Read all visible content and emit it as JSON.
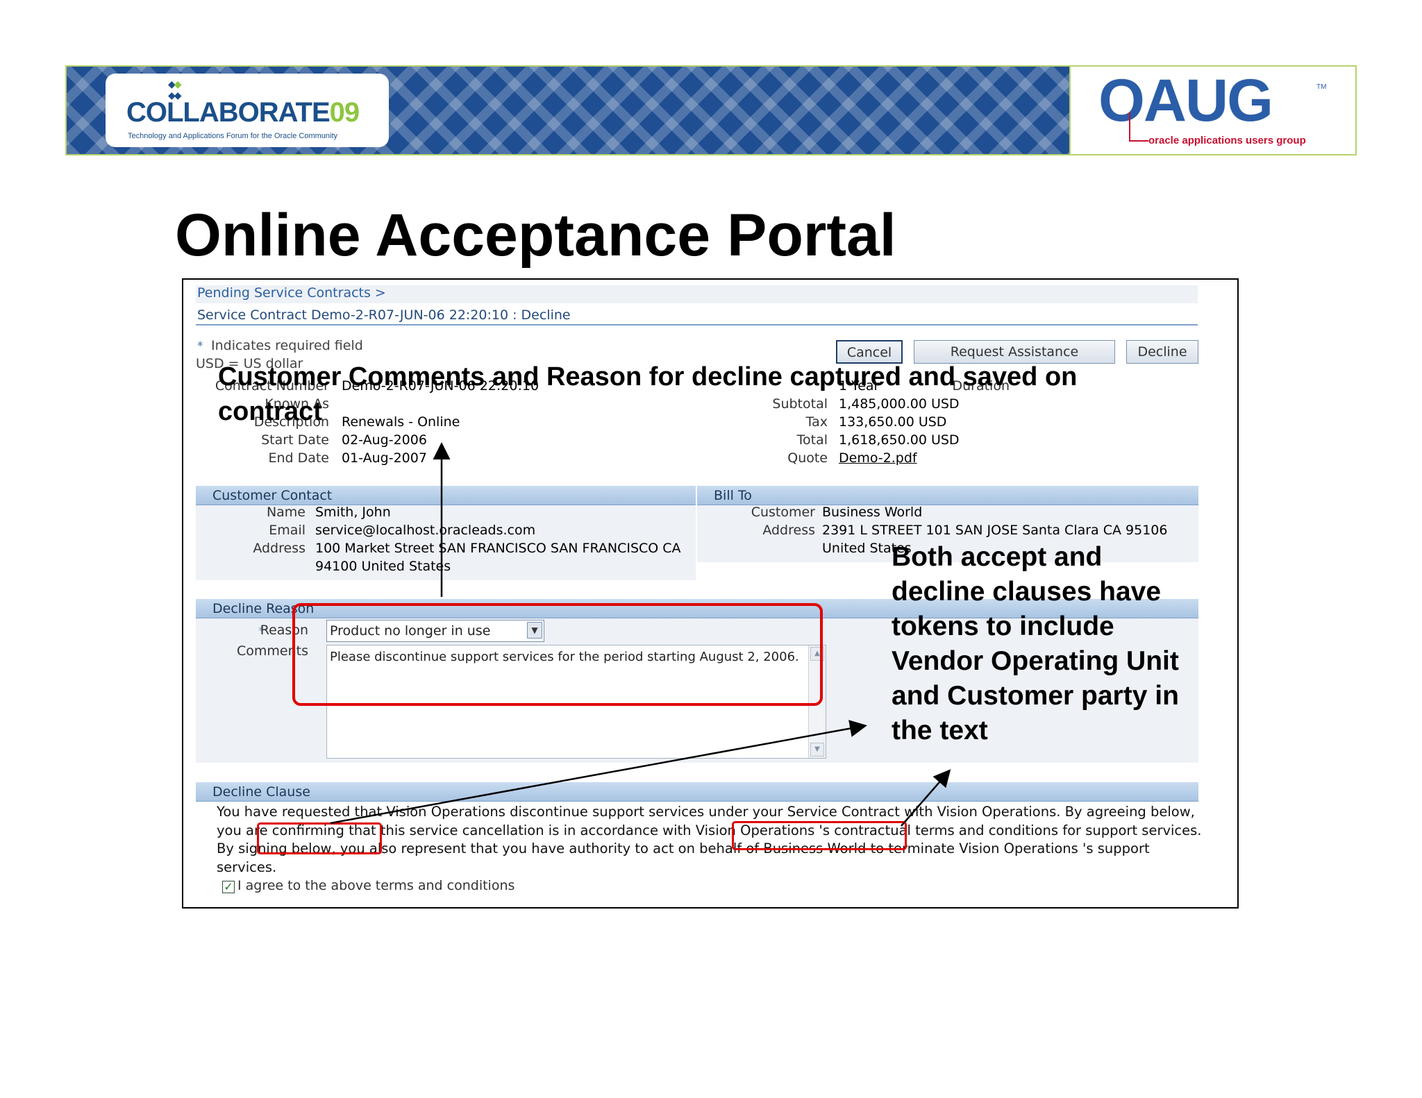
{
  "banner": {
    "collaborate_logo": "COLLABORATE",
    "collaborate_year": "09",
    "collaborate_tagline": "Technology and Applications Forum for the Oracle Community",
    "oaug_logo": "OAUG",
    "oaug_tm": "TM",
    "oaug_tagline": "oracle applications users group"
  },
  "slide_title": "Online Acceptance Portal",
  "screen": {
    "breadcrumb": "Pending Service Contracts  >",
    "page_heading": "Service Contract Demo-2-R07-JUN-06 22:20:10 : Decline",
    "required_note": "Indicates required field",
    "currency_note": "USD = US dollar",
    "buttons": {
      "cancel": "Cancel",
      "request_assistance": "Request Assistance",
      "decline": "Decline"
    },
    "contract": {
      "contract_number_label": "Contract Number",
      "contract_number_value": "Demo-2-R07-JUN-06 22:20:10",
      "known_as_label": "Known As",
      "description_label": "Description",
      "description_value": "Renewals - Online",
      "start_date_label": "Start Date",
      "start_date_value": "02-Aug-2006",
      "end_date_label": "End Date",
      "end_date_value": "01-Aug-2007",
      "duration_label": "Duration",
      "duration_value": "1 Year",
      "subtotal_label": "Subtotal",
      "subtotal_value": "1,485,000.00 USD",
      "tax_label": "Tax",
      "tax_value": "133,650.00 USD",
      "total_label": "Total",
      "total_value": "1,618,650.00 USD",
      "quote_label": "Quote",
      "quote_value": "Demo-2.pdf"
    },
    "customer_contact": {
      "header": "Customer Contact",
      "name_label": "Name",
      "name_value": "Smith, John",
      "email_label": "Email",
      "email_value": "service@localhost.oracleads.com",
      "address_label": "Address",
      "address_line1": "100 Market Street SAN FRANCISCO SAN FRANCISCO CA",
      "address_line2": "94100 United States"
    },
    "bill_to": {
      "header": "Bill To",
      "customer_label": "Customer",
      "customer_value": "Business World",
      "address_label": "Address",
      "address_line1": "2391 L STREET 101 SAN JOSE Santa Clara CA 95106",
      "address_line2": "United States"
    },
    "decline_reason": {
      "header": "Decline Reason",
      "reason_label": "Reason",
      "reason_value": "Product no longer in use",
      "comments_label": "Comments",
      "comments_value": "Please discontinue support services for the period starting August 2, 2006."
    },
    "decline_clause": {
      "header": "Decline Clause",
      "text": "You have requested that Vision Operations discontinue support services under your Service Contract with Vision Operations. By agreeing below, you are confirming that this service cancellation is in accordance with Vision Operations 's contractual terms and conditions for support services. By signing below, you also represent that you have authority to act on behalf of Business World to terminate Vision Operations 's support services.",
      "agree_label": "I agree to the above terms and conditions",
      "agree_checked": true
    }
  },
  "annotations": {
    "comments_callout_line1": "Customer Comments and Reason for decline captured and saved on",
    "comments_callout_line2": "contract",
    "tokens_callout": [
      "Both accept and",
      "decline clauses have",
      "tokens to include",
      "Vendor Operating Unit",
      "and Customer party in",
      "the text"
    ]
  },
  "colors": {
    "highlight_red": "#e00000",
    "section_header_blue": "#a8c4e2",
    "link_blue": "#2a5fa0"
  }
}
